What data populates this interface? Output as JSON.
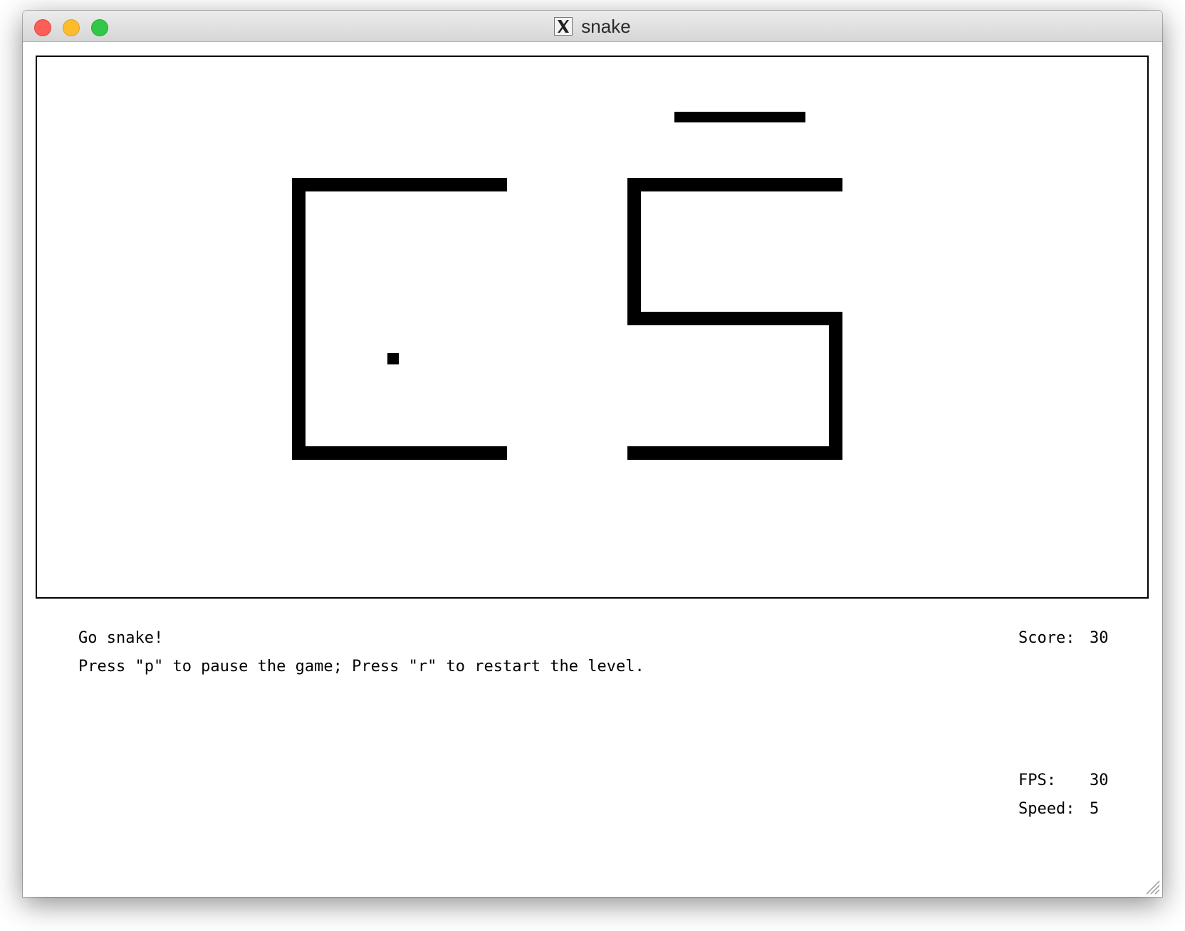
{
  "window": {
    "title": "snake",
    "app_icon": "x11-icon"
  },
  "status": {
    "message": "Go snake!",
    "instructions": "Press \"p\" to pause the game; Press \"r\" to restart the level.",
    "score_label": "Score:",
    "score_value": "30",
    "fps_label": "FPS:",
    "fps_value": "30",
    "speed_label": "Speed:",
    "speed_value": "5"
  }
}
